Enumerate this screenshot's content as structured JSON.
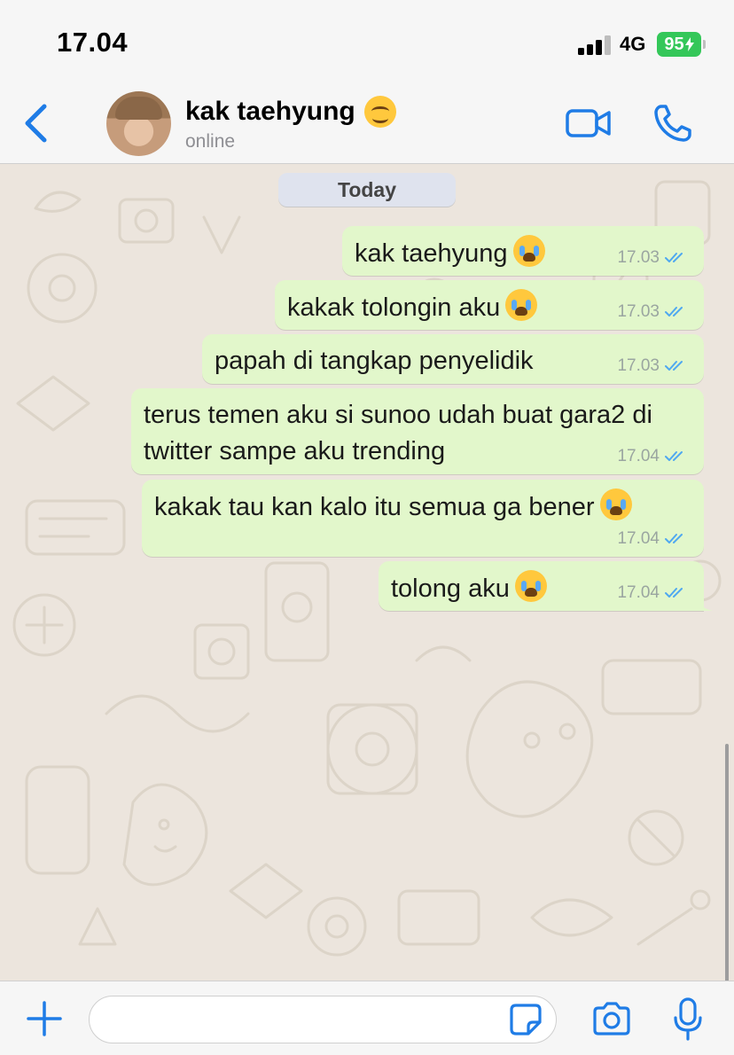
{
  "status_bar": {
    "time": "17.04",
    "network": "4G",
    "battery": "95"
  },
  "header": {
    "contact_name": "kak taehyung",
    "contact_emoji": "hugging-face",
    "status": "online",
    "icons": {
      "back": "chevron-left-icon",
      "video": "video-camera-icon",
      "call": "phone-icon"
    }
  },
  "chat": {
    "date_label": "Today",
    "messages": [
      {
        "text": "kak taehyung",
        "emoji": "loudly-crying-face",
        "time": "17.03",
        "status": "read"
      },
      {
        "text": "kakak tolongin aku",
        "emoji": "loudly-crying-face",
        "time": "17.03",
        "status": "read"
      },
      {
        "text": "papah di tangkap penyelidik",
        "emoji": "",
        "time": "17.03",
        "status": "read"
      },
      {
        "text": "terus temen aku si sunoo udah buat gara2 di twitter sampe aku trending",
        "emoji": "",
        "time": "17.04",
        "status": "read"
      },
      {
        "text": "kakak tau kan kalo itu semua ga bener",
        "emoji": "loudly-crying-face",
        "time": "17.04",
        "status": "read"
      },
      {
        "text": "tolong aku",
        "emoji": "loudly-crying-face",
        "time": "17.04",
        "status": "read"
      }
    ]
  },
  "input_bar": {
    "message_value": "",
    "icons": {
      "plus": "plus-icon",
      "sticker": "sticker-icon",
      "camera": "camera-icon",
      "mic": "microphone-icon"
    }
  },
  "colors": {
    "accent": "#1f7ce6",
    "outgoing_bubble": "#e2f7cb",
    "chat_background": "#ece5dd",
    "read_tick": "#4fa8f0",
    "battery": "#34c759"
  }
}
